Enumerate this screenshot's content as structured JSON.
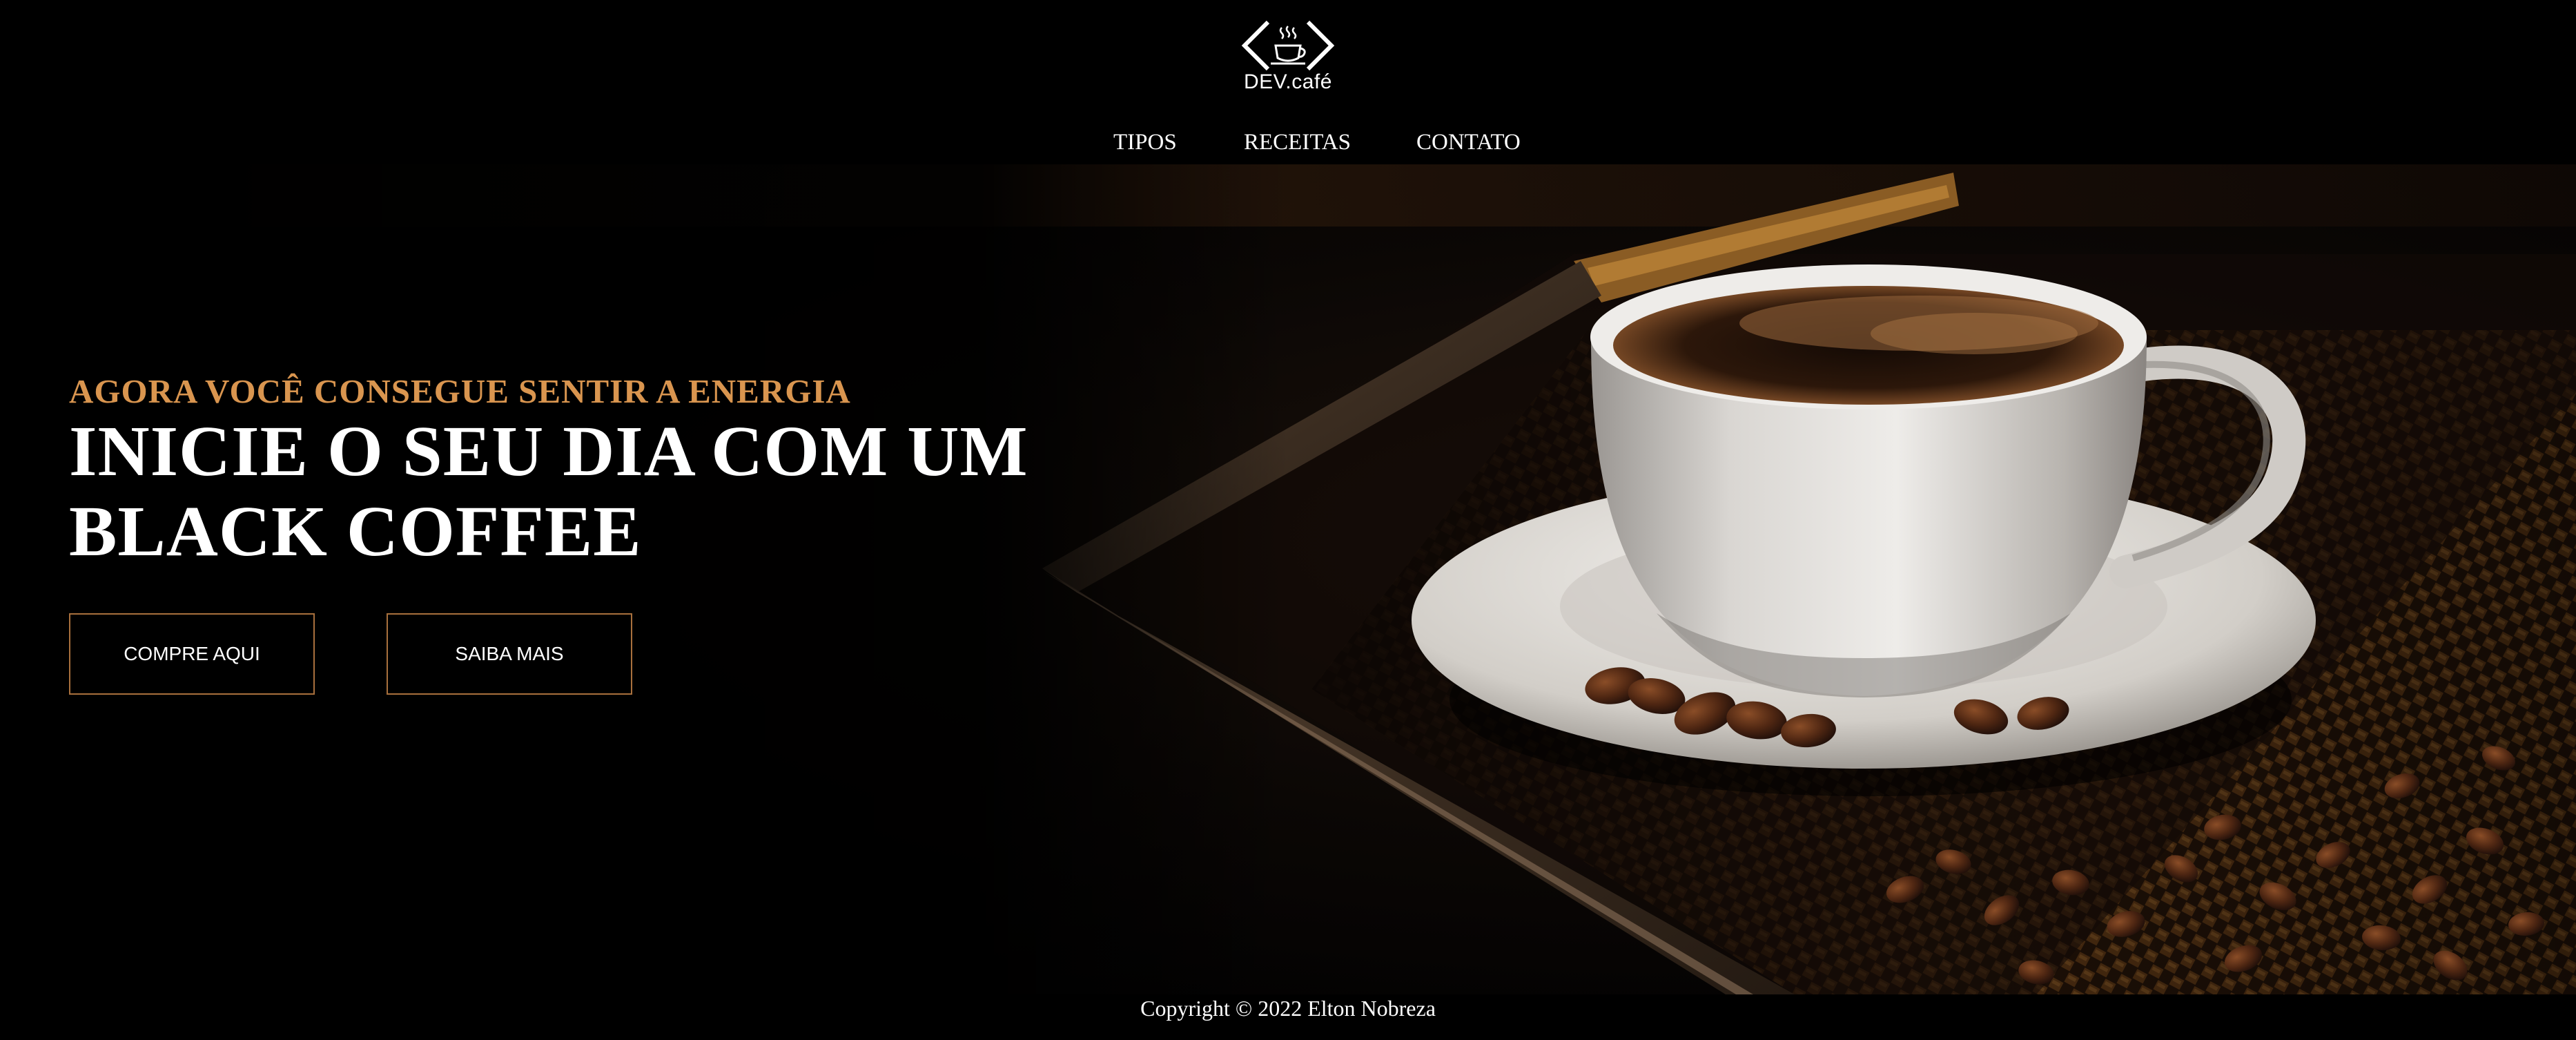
{
  "brand": {
    "logo_text": "DEV.café",
    "logo_icon": "coffee-cup-code-brackets"
  },
  "nav": {
    "items": [
      {
        "label": "TIPOS"
      },
      {
        "label": "RECEITAS"
      },
      {
        "label": "CONTATO"
      }
    ]
  },
  "hero": {
    "subtitle": "AGORA VOCÊ CONSEGUE SENTIR A ENERGIA",
    "title_line1": "INICIE O SEU DIA COM UM",
    "title_line2": "BLACK COFFEE",
    "buy_button": "COMPRE AQUI",
    "more_button": "SAIBA MAIS",
    "image_subject": "black coffee cup on wicker tray"
  },
  "footer": {
    "copyright": "Copyright © 2022 Elton Nobreza"
  },
  "colors": {
    "background": "#000000",
    "accent": "#d9954f",
    "button_border": "#a8703d",
    "text": "#ffffff"
  }
}
